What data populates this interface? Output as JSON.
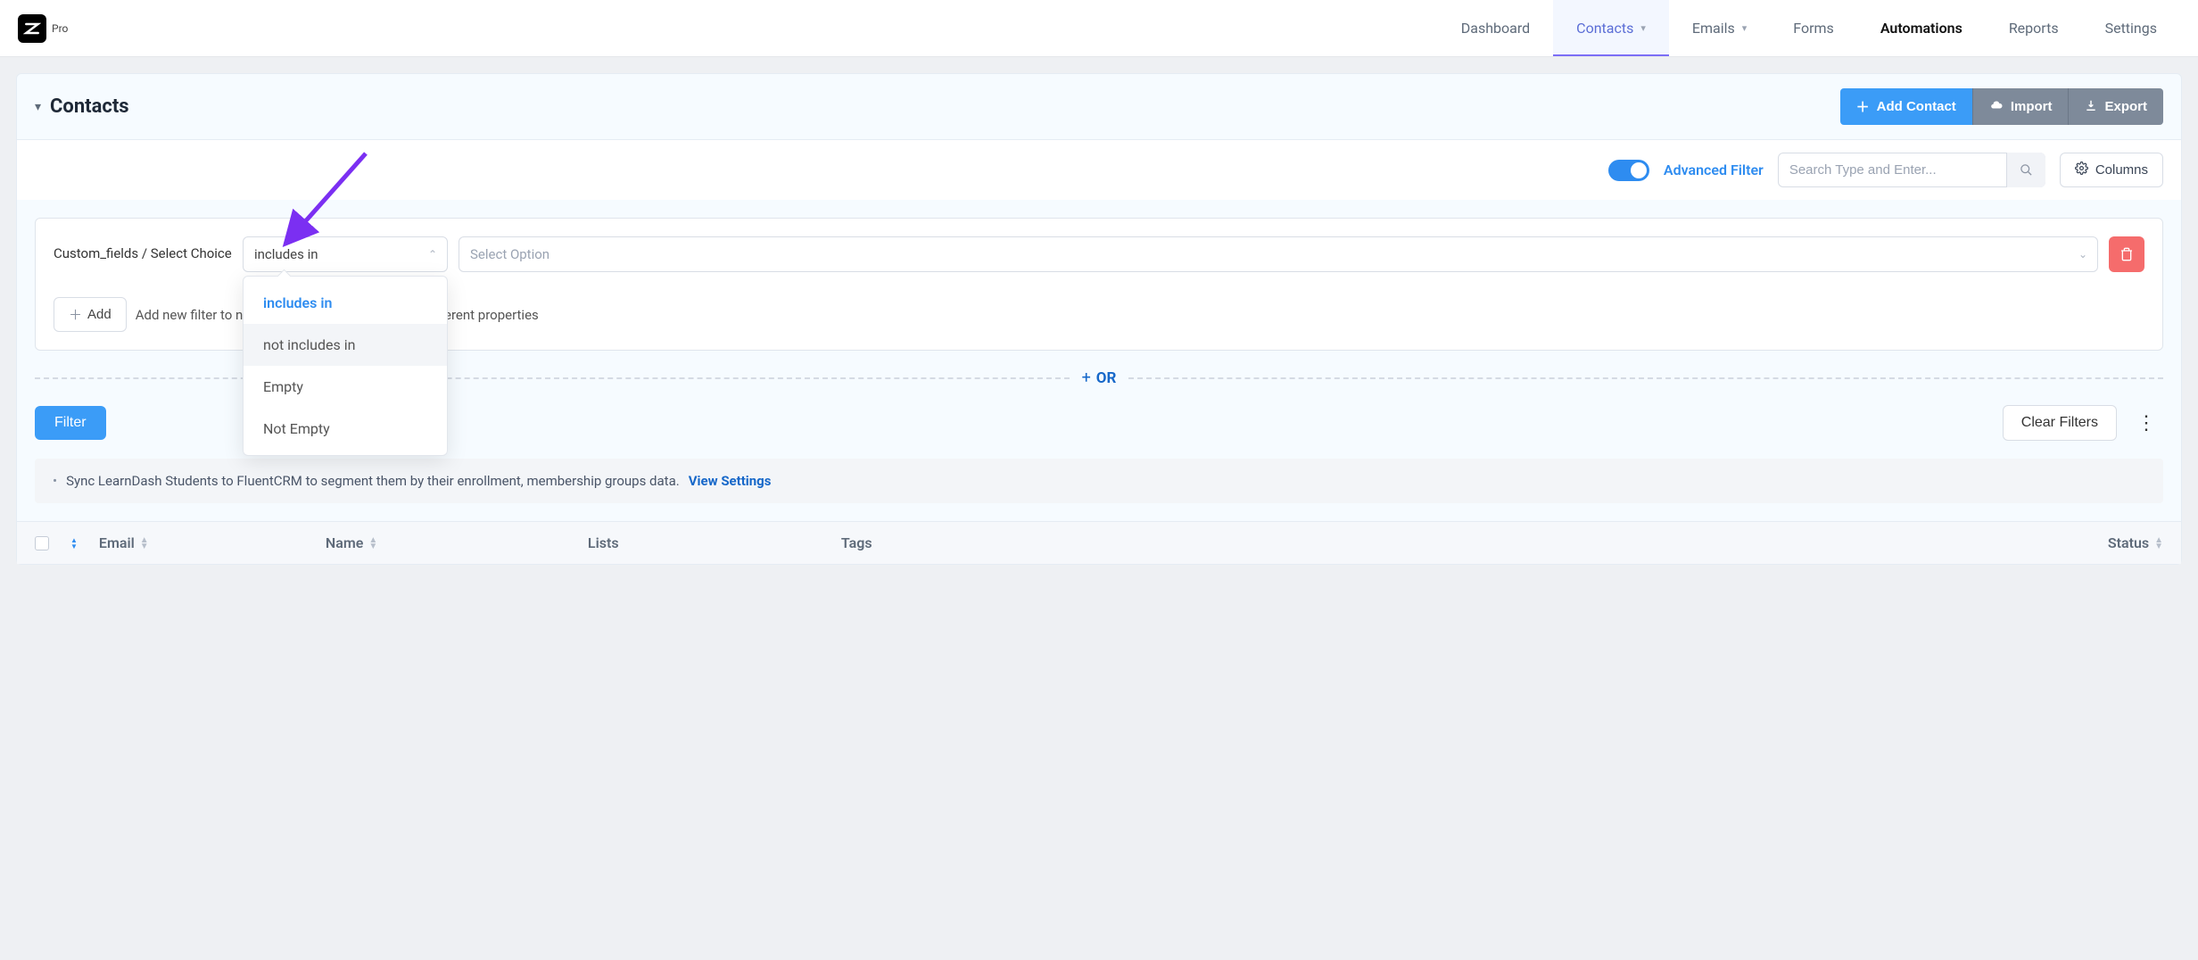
{
  "header": {
    "logo_badge": "Pro",
    "nav": {
      "dashboard": "Dashboard",
      "contacts": "Contacts",
      "emails": "Emails",
      "forms": "Forms",
      "automations": "Automations",
      "reports": "Reports",
      "settings": "Settings"
    }
  },
  "page": {
    "title": "Contacts",
    "buttons": {
      "add_contact": "Add Contact",
      "import": "Import",
      "export": "Export"
    }
  },
  "toolbar": {
    "advanced_filter": "Advanced Filter",
    "search_placeholder": "Search Type and Enter...",
    "columns": "Columns"
  },
  "filter": {
    "field_label": "Custom_fields / Select Choice",
    "operator_value": "includes in",
    "option_placeholder": "Select Option",
    "operator_options": [
      "includes in",
      "not includes in",
      "Empty",
      "Not Empty"
    ],
    "add_label": "Add",
    "add_desc_full": "Add new filter to narrow down your list based on different properties",
    "add_desc_visible_prefix": "Add new filter to n",
    "add_desc_visible_suffix": "sed on different properties"
  },
  "or_label": "OR",
  "actions": {
    "filter": "Filter",
    "clear": "Clear Filters"
  },
  "notice": {
    "text": "Sync LearnDash Students to FluentCRM to segment them by their enrollment, membership groups data.",
    "link": "View Settings"
  },
  "table": {
    "columns": {
      "email": "Email",
      "name": "Name",
      "lists": "Lists",
      "tags": "Tags",
      "status": "Status"
    }
  }
}
